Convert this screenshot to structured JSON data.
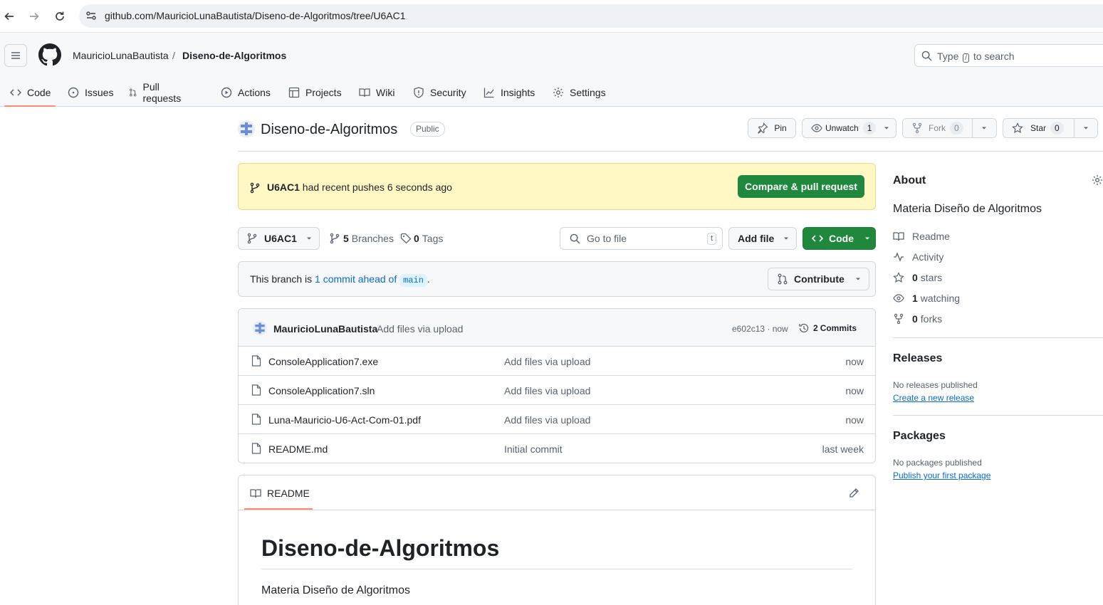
{
  "browser": {
    "url": "github.com/MauricioLunaBautista/Diseno-de-Algoritmos/tree/U6AC1"
  },
  "header": {
    "owner": "MauricioLunaBautista",
    "separator": "/",
    "repo": "Diseno-de-Algoritmos",
    "search_prefix": "Type",
    "search_key": "/",
    "search_suffix": "to search"
  },
  "tabs": [
    {
      "label": "Code",
      "icon": "code-icon",
      "active": true
    },
    {
      "label": "Issues",
      "icon": "issue-icon"
    },
    {
      "label": "Pull requests",
      "icon": "pull-request-icon"
    },
    {
      "label": "Actions",
      "icon": "play-icon"
    },
    {
      "label": "Projects",
      "icon": "table-icon"
    },
    {
      "label": "Wiki",
      "icon": "book-icon"
    },
    {
      "label": "Security",
      "icon": "shield-icon"
    },
    {
      "label": "Insights",
      "icon": "graph-icon"
    },
    {
      "label": "Settings",
      "icon": "gear-icon"
    }
  ],
  "repo": {
    "name": "Diseno-de-Algoritmos",
    "visibility": "Public",
    "pin_label": "Pin",
    "unwatch_label": "Unwatch",
    "watch_count": "1",
    "fork_label": "Fork",
    "fork_count": "0",
    "star_label": "Star",
    "star_count": "0"
  },
  "banner": {
    "branch": "U6AC1",
    "text": "had recent pushes 6 seconds ago",
    "button": "Compare & pull request"
  },
  "branchbar": {
    "branch": "U6AC1",
    "branches_count": "5",
    "branches_label": "Branches",
    "tags_count": "0",
    "tags_label": "Tags",
    "goto_placeholder": "Go to file",
    "goto_key": "t",
    "add_file": "Add file",
    "code_button": "Code"
  },
  "ahead": {
    "prefix": "This branch is",
    "link": "1 commit ahead of",
    "base": "main",
    "suffix": ".",
    "contribute": "Contribute"
  },
  "commit": {
    "author": "MauricioLunaBautista",
    "message": "Add files via upload",
    "hash_time": "e602c13 · now",
    "commits_count": "2",
    "commits_label": "Commits"
  },
  "files": [
    {
      "name": "ConsoleApplication7.exe",
      "message": "Add files via upload",
      "date": "now"
    },
    {
      "name": "ConsoleApplication7.sln",
      "message": "Add files via upload",
      "date": "now"
    },
    {
      "name": "Luna-Mauricio-U6-Act-Com-01.pdf",
      "message": "Add files via upload",
      "date": "now"
    },
    {
      "name": "README.md",
      "message": "Initial commit",
      "date": "last week"
    }
  ],
  "readme": {
    "tab": "README",
    "title": "Diseno-de-Algoritmos",
    "body": "Materia Diseño de Algoritmos"
  },
  "sidebar": {
    "about_title": "About",
    "description": "Materia Diseño de Algoritmos",
    "readme": "Readme",
    "activity": "Activity",
    "stars_count": "0",
    "stars_label": "stars",
    "watching_count": "1",
    "watching_label": "watching",
    "forks_count": "0",
    "forks_label": "forks",
    "releases_title": "Releases",
    "releases_none": "No releases published",
    "releases_link": "Create a new release",
    "packages_title": "Packages",
    "packages_none": "No packages published",
    "packages_link": "Publish your first package"
  },
  "colors": {
    "primary_green": "#1f883d",
    "link_blue": "#0969da",
    "active_tab_underline": "#fd8c73",
    "banner_yellow": "#fff8c5"
  }
}
